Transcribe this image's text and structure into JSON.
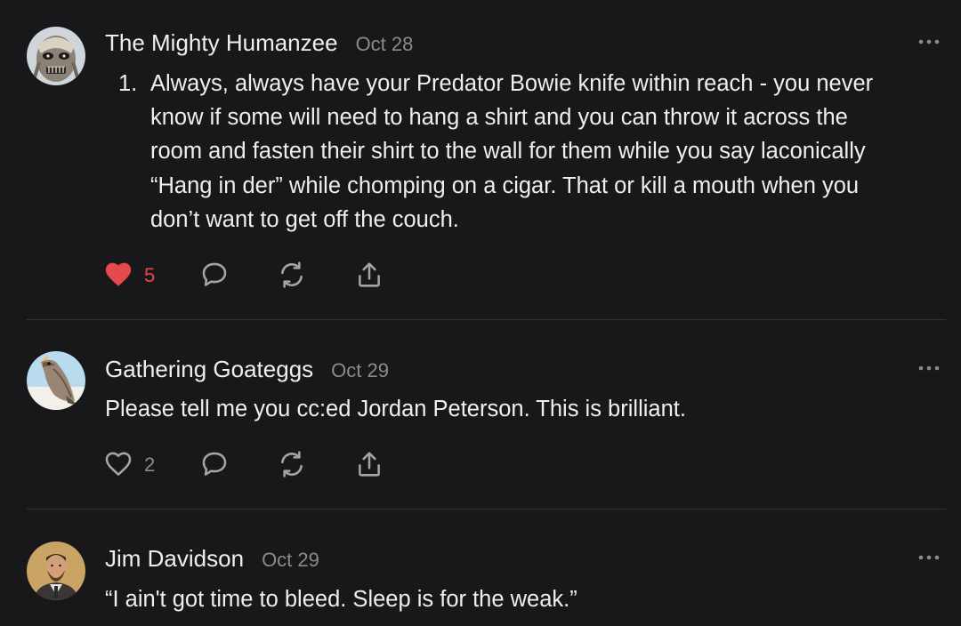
{
  "colors": {
    "background": "#18181a",
    "text": "#f0efed",
    "muted": "#8d8b88",
    "liked": "#e5484d",
    "divider": "#333336"
  },
  "comments": [
    {
      "author": "The Mighty Humanzee",
      "date": "Oct 28",
      "avatar_icon": "mask-avatar",
      "list_marker": "1.",
      "lines": [
        "Always, always have your Predator Bowie knife within reach - you never",
        "know if some will need to hang a shirt and you can throw it across the",
        "room and fasten their shirt to the wall for them while you say laconically",
        "“Hang in der” while chomping on a cigar. That or kill a mouth when you",
        "don’t want to get off the couch."
      ],
      "likes": "5",
      "liked": true
    },
    {
      "author": "Gathering Goateggs",
      "date": "Oct 29",
      "avatar_icon": "bird-avatar",
      "lines": [
        "Please tell me you cc:ed Jordan Peterson. This is brilliant."
      ],
      "likes": "2",
      "liked": false
    },
    {
      "author": "Jim Davidson",
      "date": "Oct 29",
      "avatar_icon": "person-avatar",
      "lines": [
        "“I ain't got time to bleed. Sleep is for the weak.”"
      ]
    }
  ],
  "icons": {
    "like": "heart-icon",
    "reply": "comment-icon",
    "restack": "restack-icon",
    "share": "share-icon",
    "more": "more-icon"
  }
}
